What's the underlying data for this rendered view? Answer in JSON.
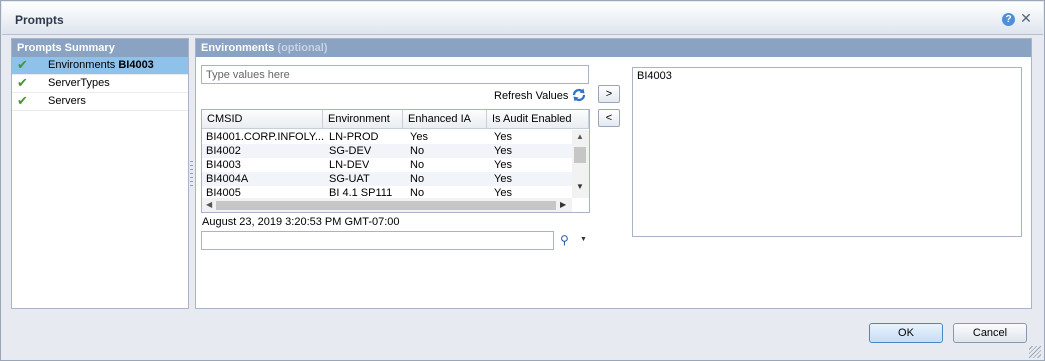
{
  "window": {
    "title": "Prompts"
  },
  "summary": {
    "header": "Prompts Summary",
    "items": [
      {
        "label": "Environments",
        "value": "BI4003",
        "selected": true
      },
      {
        "label": "ServerTypes",
        "value": "",
        "selected": false
      },
      {
        "label": "Servers",
        "value": "",
        "selected": false
      }
    ]
  },
  "environments": {
    "header": "Environments",
    "optional_label": "(optional)",
    "search_placeholder": "Type values here",
    "refresh_label": "Refresh Values",
    "columns": [
      "CMSID",
      "Environment",
      "Enhanced IA",
      "Is Audit Enabled"
    ],
    "rows": [
      [
        "BI4001.CORP.INFOLY...",
        "LN-PROD",
        "Yes",
        "Yes"
      ],
      [
        "BI4002",
        "SG-DEV",
        "No",
        "Yes"
      ],
      [
        "BI4003",
        "LN-DEV",
        "No",
        "Yes"
      ],
      [
        "BI4004A",
        "SG-UAT",
        "No",
        "Yes"
      ],
      [
        "BI4005",
        "BI 4.1 SP111",
        "No",
        "Yes"
      ]
    ],
    "timestamp": "August 23, 2019 3:20:53 PM GMT-07:00",
    "add_label": ">",
    "remove_label": "<",
    "selected_values": [
      "BI4003"
    ]
  },
  "footer": {
    "ok_label": "OK",
    "cancel_label": "Cancel"
  },
  "colors": {
    "header_bg": "#8ba3c3",
    "selected_bg": "#8fc2ea",
    "check": "#3d9b2a"
  }
}
